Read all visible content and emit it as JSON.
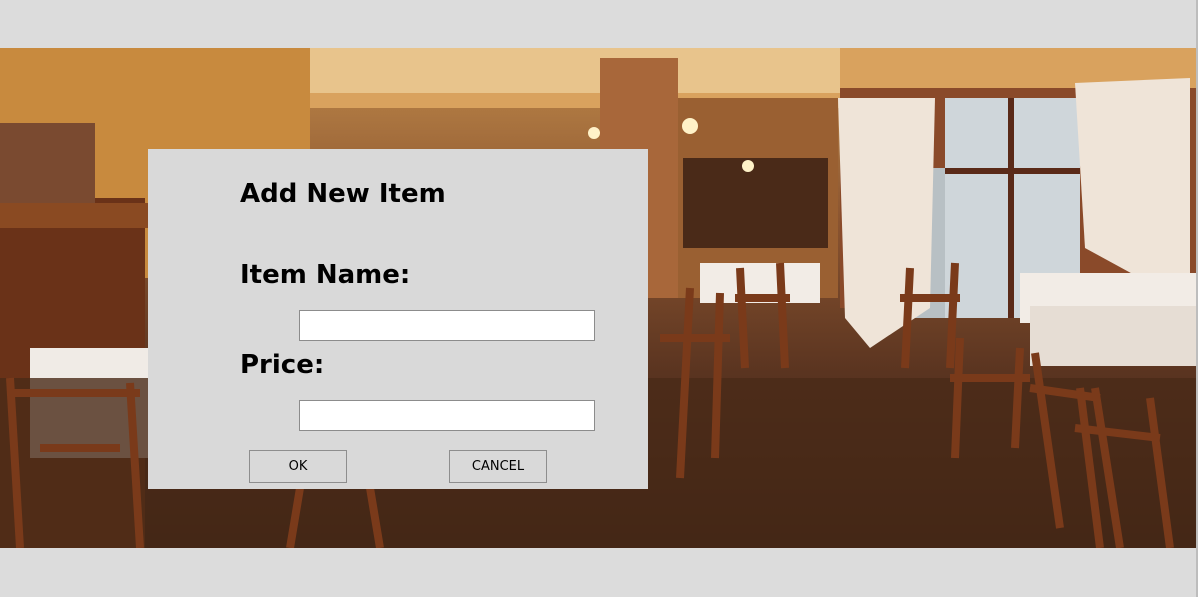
{
  "dialog": {
    "title": "Add New Item",
    "item_name_label": "Item Name:",
    "item_name_value": "",
    "price_label": "Price:",
    "price_value": "",
    "ok_label": "OK",
    "cancel_label": "CANCEL"
  },
  "colors": {
    "window_background": "#dcdcdc",
    "dialog_background": "#d9d9d9",
    "input_background": "#ffffff"
  }
}
